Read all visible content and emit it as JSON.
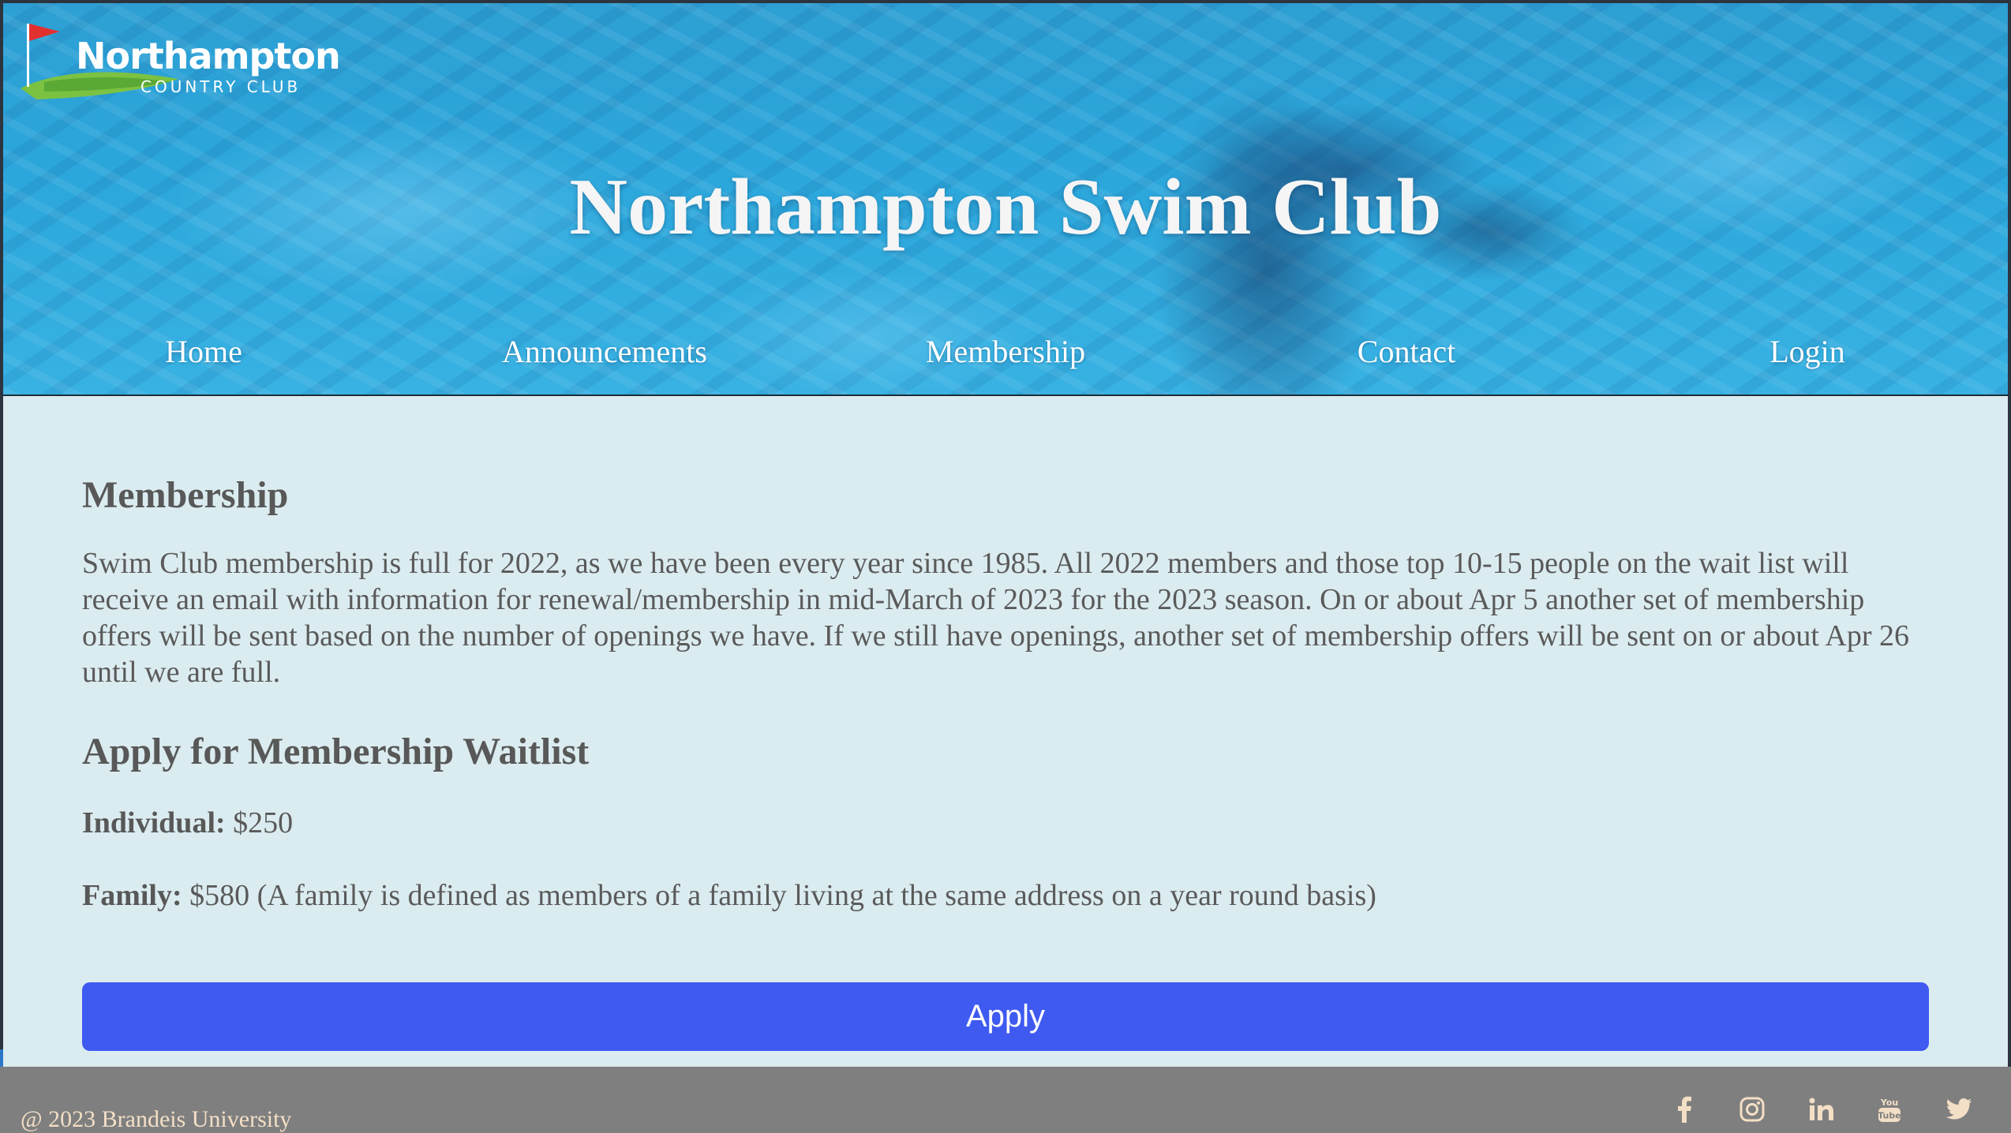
{
  "brand": {
    "logo_name": "Northampton",
    "logo_sub": "COUNTRY CLUB",
    "site_title": "Northampton Swim Club"
  },
  "nav": {
    "items": [
      {
        "label": "Home"
      },
      {
        "label": "Announcements"
      },
      {
        "label": "Membership"
      },
      {
        "label": "Contact"
      },
      {
        "label": "Login"
      }
    ]
  },
  "main": {
    "heading": "Membership",
    "paragraph": "Swim Club membership is full for 2022, as we have been every year since 1985. All 2022 members and those top 10-15 people on the wait list will receive an email with information for renewal/membership in mid-March of 2023 for the 2023 season. On or about Apr 5 another set of membership offers will be sent based on the number of openings we have. If we still have openings, another set of membership offers will be sent on or about Apr 26 until we are full.",
    "waitlist_heading": "Apply for Membership Waitlist",
    "individual_label": "Individual:",
    "individual_value": " $250",
    "family_label": "Family:",
    "family_value": " $580 (A family is defined as members of a family living at the same address on a year round basis)",
    "apply_label": "Apply"
  },
  "footer": {
    "copyright": "@ 2023 Brandeis University",
    "social_icons": [
      "facebook-icon",
      "instagram-icon",
      "linkedin-icon",
      "youtube-icon",
      "twitter-icon"
    ]
  },
  "colors": {
    "content_bg": "#dbecf0",
    "apply_button": "#3e5af0",
    "footer_bg": "#7f7f7f",
    "footer_text": "#f3dfc6",
    "body_text": "#5a5a5a"
  }
}
